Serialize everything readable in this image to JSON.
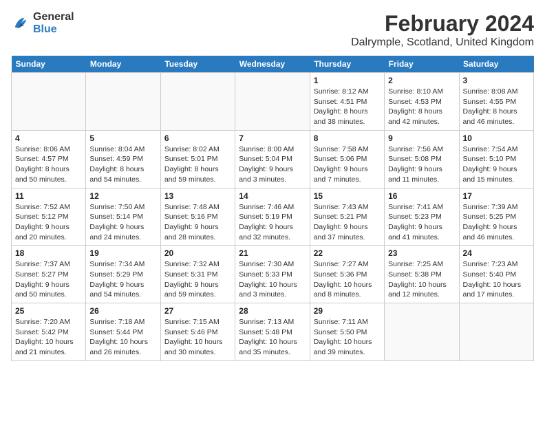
{
  "header": {
    "logo_line1": "General",
    "logo_line2": "Blue",
    "main_title": "February 2024",
    "subtitle": "Dalrymple, Scotland, United Kingdom"
  },
  "weekdays": [
    "Sunday",
    "Monday",
    "Tuesday",
    "Wednesday",
    "Thursday",
    "Friday",
    "Saturday"
  ],
  "weeks": [
    [
      {
        "day": "",
        "sunrise": "",
        "sunset": "",
        "daylight": ""
      },
      {
        "day": "",
        "sunrise": "",
        "sunset": "",
        "daylight": ""
      },
      {
        "day": "",
        "sunrise": "",
        "sunset": "",
        "daylight": ""
      },
      {
        "day": "",
        "sunrise": "",
        "sunset": "",
        "daylight": ""
      },
      {
        "day": "1",
        "sunrise": "Sunrise: 8:12 AM",
        "sunset": "Sunset: 4:51 PM",
        "daylight": "Daylight: 8 hours and 38 minutes."
      },
      {
        "day": "2",
        "sunrise": "Sunrise: 8:10 AM",
        "sunset": "Sunset: 4:53 PM",
        "daylight": "Daylight: 8 hours and 42 minutes."
      },
      {
        "day": "3",
        "sunrise": "Sunrise: 8:08 AM",
        "sunset": "Sunset: 4:55 PM",
        "daylight": "Daylight: 8 hours and 46 minutes."
      }
    ],
    [
      {
        "day": "4",
        "sunrise": "Sunrise: 8:06 AM",
        "sunset": "Sunset: 4:57 PM",
        "daylight": "Daylight: 8 hours and 50 minutes."
      },
      {
        "day": "5",
        "sunrise": "Sunrise: 8:04 AM",
        "sunset": "Sunset: 4:59 PM",
        "daylight": "Daylight: 8 hours and 54 minutes."
      },
      {
        "day": "6",
        "sunrise": "Sunrise: 8:02 AM",
        "sunset": "Sunset: 5:01 PM",
        "daylight": "Daylight: 8 hours and 59 minutes."
      },
      {
        "day": "7",
        "sunrise": "Sunrise: 8:00 AM",
        "sunset": "Sunset: 5:04 PM",
        "daylight": "Daylight: 9 hours and 3 minutes."
      },
      {
        "day": "8",
        "sunrise": "Sunrise: 7:58 AM",
        "sunset": "Sunset: 5:06 PM",
        "daylight": "Daylight: 9 hours and 7 minutes."
      },
      {
        "day": "9",
        "sunrise": "Sunrise: 7:56 AM",
        "sunset": "Sunset: 5:08 PM",
        "daylight": "Daylight: 9 hours and 11 minutes."
      },
      {
        "day": "10",
        "sunrise": "Sunrise: 7:54 AM",
        "sunset": "Sunset: 5:10 PM",
        "daylight": "Daylight: 9 hours and 15 minutes."
      }
    ],
    [
      {
        "day": "11",
        "sunrise": "Sunrise: 7:52 AM",
        "sunset": "Sunset: 5:12 PM",
        "daylight": "Daylight: 9 hours and 20 minutes."
      },
      {
        "day": "12",
        "sunrise": "Sunrise: 7:50 AM",
        "sunset": "Sunset: 5:14 PM",
        "daylight": "Daylight: 9 hours and 24 minutes."
      },
      {
        "day": "13",
        "sunrise": "Sunrise: 7:48 AM",
        "sunset": "Sunset: 5:16 PM",
        "daylight": "Daylight: 9 hours and 28 minutes."
      },
      {
        "day": "14",
        "sunrise": "Sunrise: 7:46 AM",
        "sunset": "Sunset: 5:19 PM",
        "daylight": "Daylight: 9 hours and 32 minutes."
      },
      {
        "day": "15",
        "sunrise": "Sunrise: 7:43 AM",
        "sunset": "Sunset: 5:21 PM",
        "daylight": "Daylight: 9 hours and 37 minutes."
      },
      {
        "day": "16",
        "sunrise": "Sunrise: 7:41 AM",
        "sunset": "Sunset: 5:23 PM",
        "daylight": "Daylight: 9 hours and 41 minutes."
      },
      {
        "day": "17",
        "sunrise": "Sunrise: 7:39 AM",
        "sunset": "Sunset: 5:25 PM",
        "daylight": "Daylight: 9 hours and 46 minutes."
      }
    ],
    [
      {
        "day": "18",
        "sunrise": "Sunrise: 7:37 AM",
        "sunset": "Sunset: 5:27 PM",
        "daylight": "Daylight: 9 hours and 50 minutes."
      },
      {
        "day": "19",
        "sunrise": "Sunrise: 7:34 AM",
        "sunset": "Sunset: 5:29 PM",
        "daylight": "Daylight: 9 hours and 54 minutes."
      },
      {
        "day": "20",
        "sunrise": "Sunrise: 7:32 AM",
        "sunset": "Sunset: 5:31 PM",
        "daylight": "Daylight: 9 hours and 59 minutes."
      },
      {
        "day": "21",
        "sunrise": "Sunrise: 7:30 AM",
        "sunset": "Sunset: 5:33 PM",
        "daylight": "Daylight: 10 hours and 3 minutes."
      },
      {
        "day": "22",
        "sunrise": "Sunrise: 7:27 AM",
        "sunset": "Sunset: 5:36 PM",
        "daylight": "Daylight: 10 hours and 8 minutes."
      },
      {
        "day": "23",
        "sunrise": "Sunrise: 7:25 AM",
        "sunset": "Sunset: 5:38 PM",
        "daylight": "Daylight: 10 hours and 12 minutes."
      },
      {
        "day": "24",
        "sunrise": "Sunrise: 7:23 AM",
        "sunset": "Sunset: 5:40 PM",
        "daylight": "Daylight: 10 hours and 17 minutes."
      }
    ],
    [
      {
        "day": "25",
        "sunrise": "Sunrise: 7:20 AM",
        "sunset": "Sunset: 5:42 PM",
        "daylight": "Daylight: 10 hours and 21 minutes."
      },
      {
        "day": "26",
        "sunrise": "Sunrise: 7:18 AM",
        "sunset": "Sunset: 5:44 PM",
        "daylight": "Daylight: 10 hours and 26 minutes."
      },
      {
        "day": "27",
        "sunrise": "Sunrise: 7:15 AM",
        "sunset": "Sunset: 5:46 PM",
        "daylight": "Daylight: 10 hours and 30 minutes."
      },
      {
        "day": "28",
        "sunrise": "Sunrise: 7:13 AM",
        "sunset": "Sunset: 5:48 PM",
        "daylight": "Daylight: 10 hours and 35 minutes."
      },
      {
        "day": "29",
        "sunrise": "Sunrise: 7:11 AM",
        "sunset": "Sunset: 5:50 PM",
        "daylight": "Daylight: 10 hours and 39 minutes."
      },
      {
        "day": "",
        "sunrise": "",
        "sunset": "",
        "daylight": ""
      },
      {
        "day": "",
        "sunrise": "",
        "sunset": "",
        "daylight": ""
      }
    ]
  ]
}
